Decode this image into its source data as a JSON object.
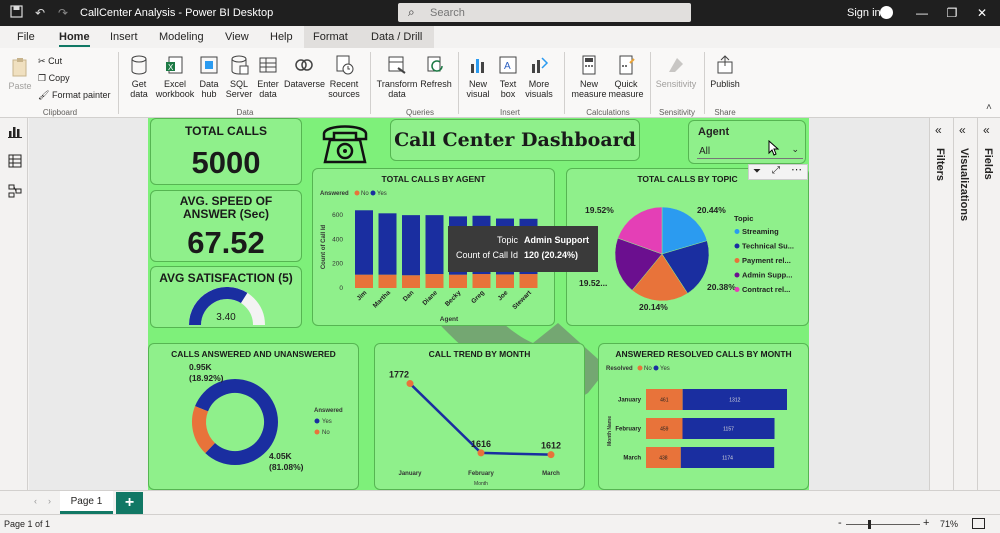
{
  "window": {
    "title": "CallCenter Analysis - Power BI Desktop",
    "search_placeholder": "Search",
    "signin": "Sign in"
  },
  "menu": {
    "tabs": [
      "File",
      "Home",
      "Insert",
      "Modeling",
      "View",
      "Help",
      "Format",
      "Data / Drill"
    ],
    "active": "Home"
  },
  "ribbon": {
    "clipboard": {
      "paste": "Paste",
      "cut": "Cut",
      "copy": "Copy",
      "format_painter": "Format painter",
      "group": "Clipboard"
    },
    "data": {
      "get_data": "Get data",
      "excel": "Excel workbook",
      "data_hub": "Data hub",
      "sql": "SQL Server",
      "enter_data": "Enter data",
      "dataverse": "Dataverse",
      "recent": "Recent sources",
      "group": "Data"
    },
    "queries": {
      "transform": "Transform data",
      "refresh": "Refresh",
      "group": "Queries"
    },
    "insert": {
      "new_visual": "New visual",
      "text_box": "Text box",
      "more_visuals": "More visuals",
      "group": "Insert"
    },
    "calculations": {
      "new_measure": "New measure",
      "quick_measure": "Quick measure",
      "group": "Calculations"
    },
    "sensitivity": {
      "label": "Sensitivity",
      "group": "Sensitivity"
    },
    "share": {
      "publish": "Publish",
      "group": "Share"
    }
  },
  "dashboard": {
    "title": "Call Center Dashboard",
    "total_calls": {
      "label": "TOTAL CALLS",
      "value": "5000"
    },
    "avg_speed": {
      "label": "AVG. SPEED OF ANSWER (Sec)",
      "value": "67.52"
    },
    "avg_satisfaction": {
      "label": "AVG SATISFACTION (5)",
      "value": "3.40",
      "fraction": 0.68
    },
    "agent_slicer": {
      "label": "Agent",
      "value": "All"
    },
    "tooltip": {
      "topic_label": "Topic",
      "topic_value": "Admin Support",
      "count_label": "Count of Call Id",
      "count_value": "120 (20.24%)"
    }
  },
  "panes": {
    "filters": "Filters",
    "visualizations": "Visualizations",
    "fields": "Fields"
  },
  "pages": {
    "tab": "Page 1",
    "add": "+"
  },
  "status": {
    "page": "Page 1 of 1",
    "zoom": "71%",
    "minus": "-",
    "plus": "+"
  },
  "colors": {
    "report_bg": "#7ef07a",
    "card_bg": "#8ff08b",
    "blue": "#1a2ea0",
    "orange": "#e8733a",
    "accent": "#117865"
  },
  "chart_data": [
    {
      "type": "bar",
      "title": "TOTAL CALLS BY AGENT",
      "xlabel": "Agent",
      "ylabel": "Count of Call Id",
      "legend_title": "Answered",
      "categories": [
        "Jim",
        "Martha",
        "Dan",
        "Diane",
        "Becky",
        "Greg",
        "Joe",
        "Stewart"
      ],
      "series": [
        {
          "name": "No",
          "values": [
            110,
            110,
            105,
            115,
            110,
            115,
            112,
            115
          ]
        },
        {
          "name": "Yes",
          "values": [
            530,
            505,
            495,
            485,
            480,
            480,
            460,
            455
          ]
        }
      ],
      "yticks": [
        "0",
        "200",
        "400",
        "600"
      ],
      "ylim": [
        0,
        700
      ]
    },
    {
      "type": "pie",
      "title": "TOTAL CALLS BY TOPIC",
      "legend_title": "Topic",
      "labels": [
        "Streaming",
        "Technical Su...",
        "Payment rel...",
        "Admin Supp...",
        "Contract rel..."
      ],
      "values": [
        20.44,
        20.38,
        20.14,
        19.52,
        19.52
      ],
      "value_labels": [
        "20.44%",
        "20.38%",
        "20.14%",
        "19.52...",
        "19.52%"
      ],
      "colors": [
        "#2b9bf0",
        "#1a2ea0",
        "#e8733a",
        "#6b0f8f",
        "#e43fb6"
      ]
    },
    {
      "type": "pie",
      "title": "CALLS ANSWERED AND UNANSWERED",
      "legend_title": "Answered",
      "labels": [
        "Yes",
        "No"
      ],
      "values": [
        4050,
        950
      ],
      "value_labels": [
        "4.05K\n(81.08%)",
        "0.95K\n(18.92%)"
      ],
      "colors": [
        "#1a2ea0",
        "#e8733a"
      ]
    },
    {
      "type": "line",
      "title": "CALL TREND BY MONTH",
      "xlabel": "Month",
      "categories": [
        "January",
        "February",
        "March"
      ],
      "values": [
        1772,
        1616,
        1612
      ],
      "value_labels": [
        "1772",
        "1616",
        "1612"
      ]
    },
    {
      "type": "bar",
      "title": "ANSWERED RESOLVED CALLS BY MONTH",
      "orientation": "horizontal",
      "ylabel": "Month Name",
      "legend_title": "Resolved",
      "categories": [
        "January",
        "February",
        "March"
      ],
      "series": [
        {
          "name": "No",
          "values": [
            461,
            459,
            438
          ]
        },
        {
          "name": "Yes",
          "values": [
            1312,
            1157,
            1174
          ]
        }
      ],
      "value_labels_no": [
        "461",
        "459",
        "438"
      ],
      "value_labels_yes": [
        "1312",
        "1157",
        "1174"
      ]
    }
  ]
}
